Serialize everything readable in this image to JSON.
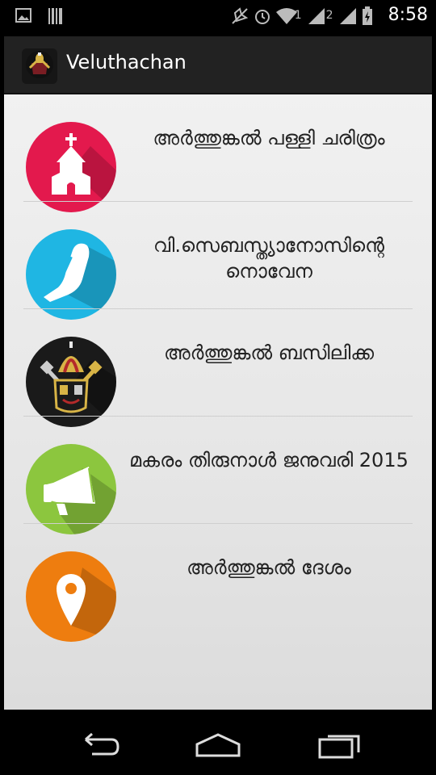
{
  "status_bar": {
    "time": "8:58",
    "sim1": "1",
    "sim2": "2",
    "icons": [
      "image-icon",
      "barcode-icon",
      "mute-icon",
      "alarm-icon",
      "wifi-icon",
      "signal-icon",
      "signal-icon",
      "battery-charging-icon"
    ]
  },
  "action_bar": {
    "title": "Veluthachan",
    "app_icon": "papal-emblem-icon"
  },
  "menu": [
    {
      "label": "അർത്തുങ്കൽ പള്ളി ചരിത്രം",
      "icon": "church-icon",
      "color": "#e3194d"
    },
    {
      "label": "വി.സെബസ്ത്യാനോസിന്റെ നൊവേന",
      "icon": "praying-hands-icon",
      "color": "#1fb6e3"
    },
    {
      "label": "അർത്തുങ്കൽ ബസിലിക്ക",
      "icon": "papal-emblem-icon",
      "color": "#1a1a1a"
    },
    {
      "label": "മകരം തിരുനാൾ ജനുവരി 2015",
      "icon": "megaphone-icon",
      "color": "#8cc63e"
    },
    {
      "label": "അർത്തുങ്കൽ ദേശം",
      "icon": "location-pin-icon",
      "color": "#ee7d0f"
    }
  ],
  "nav_bar": {
    "icons": [
      "back-icon",
      "home-icon",
      "recents-icon"
    ]
  }
}
